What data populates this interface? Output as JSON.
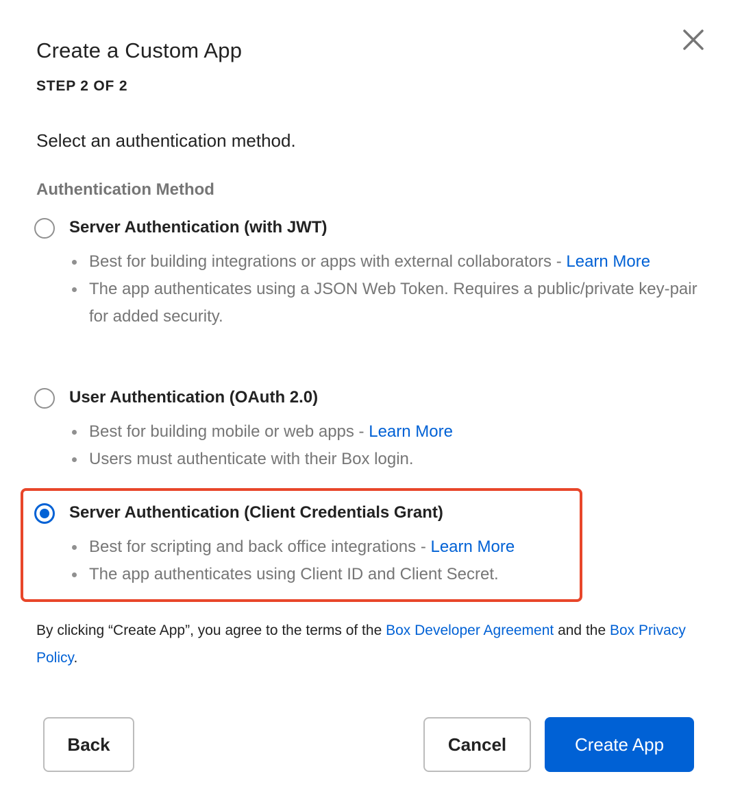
{
  "dialog": {
    "title": "Create a Custom App",
    "step": "STEP 2 OF 2",
    "intro": "Select an authentication method.",
    "section_label": "Authentication Method",
    "close_icon": "close-icon"
  },
  "options": [
    {
      "label": "Server Authentication (with JWT)",
      "selected": false,
      "bullet1_text": "Best for building integrations or apps with external collaborators - ",
      "bullet1_link": "Learn More",
      "bullet2_text": "The app authenticates using a JSON Web Token. Requires a public/private key-pair for added security."
    },
    {
      "label": "User Authentication (OAuth 2.0)",
      "selected": false,
      "bullet1_text": "Best for building mobile or web apps - ",
      "bullet1_link": "Learn More",
      "bullet2_text": "Users must authenticate with their Box login."
    },
    {
      "label": "Server Authentication (Client Credentials Grant)",
      "selected": true,
      "bullet1_text": "Best for scripting and back office integrations - ",
      "bullet1_link": "Learn More",
      "bullet2_text": "The app authenticates using Client ID and Client Secret."
    }
  ],
  "terms": {
    "prefix": "By clicking “Create App”, you agree to the terms of the ",
    "link1": "Box Developer Agreement",
    "middle": " and the ",
    "link2": "Box Privacy Policy",
    "suffix": "."
  },
  "buttons": {
    "back": "Back",
    "cancel": "Cancel",
    "create": "Create App"
  },
  "colors": {
    "accent": "#0061d5",
    "highlight": "#e8462a"
  }
}
